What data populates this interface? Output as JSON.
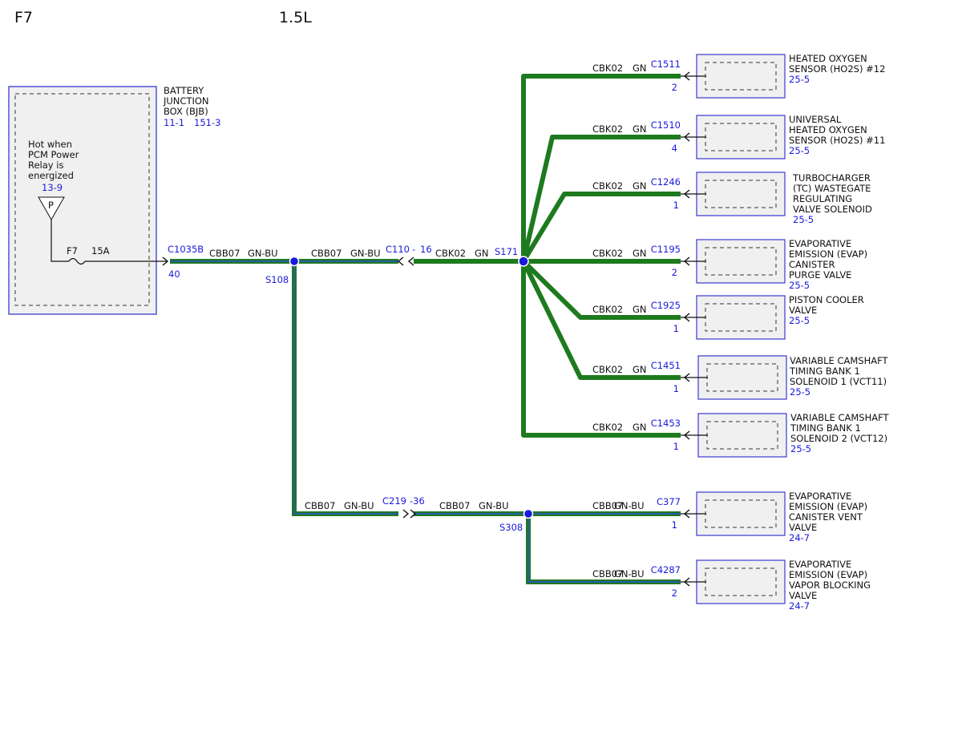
{
  "header": {
    "fuse": "F7",
    "engine": "1.5L"
  },
  "colors": {
    "wire_gn": "#1e7a1e",
    "wire_stripe_bu": "#2a5aa8",
    "ref_blue": "#1a1adc",
    "box_border": "#3a3ad0",
    "box_fill": "#f0f0f0"
  },
  "bjb": {
    "name": [
      "BATTERY",
      "JUNCTION",
      "BOX (BJB)"
    ],
    "refs": [
      "11-1",
      "151-3"
    ],
    "note": [
      "Hot when",
      "PCM Power",
      "Relay is",
      "energized"
    ],
    "note_ref": "13-9",
    "power_symbol": "P",
    "fuse": "F7",
    "rating": "15A",
    "connector": "C1035B",
    "pin": "40"
  },
  "splices": {
    "s108": "S108",
    "s171": "S171",
    "s308": "S308"
  },
  "segments": {
    "bjb_to_s108": {
      "circuit": "CBB07",
      "color": "GN-BU"
    },
    "s108_to_c110": {
      "circuit": "CBB07",
      "color": "GN-BU"
    },
    "c110": {
      "name": "C110",
      "dash": "-",
      "pin": "16"
    },
    "c110_to_s171": {
      "circuit": "CBK02",
      "color": "GN"
    },
    "s108_to_c219": {
      "circuit": "CBB07",
      "color": "GN-BU"
    },
    "c219": {
      "name": "C219",
      "pin": "-36"
    },
    "c219_to_s308": {
      "circuit": "CBB07",
      "color": "GN-BU"
    }
  },
  "loads": [
    {
      "circuit": "CBK02",
      "color": "GN",
      "connector": "C1511",
      "pin": "2",
      "name": [
        "HEATED OXYGEN",
        "SENSOR (HO2S) #12"
      ],
      "ref": "25-5"
    },
    {
      "circuit": "CBK02",
      "color": "GN",
      "connector": "C1510",
      "pin": "4",
      "name": [
        "UNIVERSAL",
        "HEATED OXYGEN",
        "SENSOR (HO2S) #11"
      ],
      "ref": "25-5"
    },
    {
      "circuit": "CBK02",
      "color": "GN",
      "connector": "C1246",
      "pin": "1",
      "name": [
        "TURBOCHARGER",
        "(TC) WASTEGATE",
        "REGULATING",
        "VALVE SOLENOID"
      ],
      "ref": "25-5"
    },
    {
      "circuit": "CBK02",
      "color": "GN",
      "connector": "C1195",
      "pin": "2",
      "name": [
        "EVAPORATIVE",
        "EMISSION (EVAP)",
        "CANISTER",
        "PURGE VALVE"
      ],
      "ref": "25-5"
    },
    {
      "circuit": "CBK02",
      "color": "GN",
      "connector": "C1925",
      "pin": "1",
      "name": [
        "PISTON COOLER",
        "VALVE"
      ],
      "ref": "25-5"
    },
    {
      "circuit": "CBK02",
      "color": "GN",
      "connector": "C1451",
      "pin": "1",
      "name": [
        "VARIABLE CAMSHAFT",
        "TIMING BANK 1",
        "SOLENOID 1 (VCT11)"
      ],
      "ref": "25-5"
    },
    {
      "circuit": "CBK02",
      "color": "GN",
      "connector": "C1453",
      "pin": "1",
      "name": [
        "VARIABLE CAMSHAFT",
        "TIMING BANK 1",
        "SOLENOID 2 (VCT12)"
      ],
      "ref": "25-5"
    },
    {
      "circuit": "CBB07",
      "color": "GN-BU",
      "connector": "C377",
      "pin": "1",
      "name": [
        "EVAPORATIVE",
        "EMISSION (EVAP)",
        "CANISTER VENT",
        "VALVE"
      ],
      "ref": "24-7"
    },
    {
      "circuit": "CBB07",
      "color": "GN-BU",
      "connector": "C4287",
      "pin": "2",
      "name": [
        "EVAPORATIVE",
        "EMISSION (EVAP)",
        "VAPOR BLOCKING",
        "VALVE"
      ],
      "ref": "24-7"
    }
  ]
}
